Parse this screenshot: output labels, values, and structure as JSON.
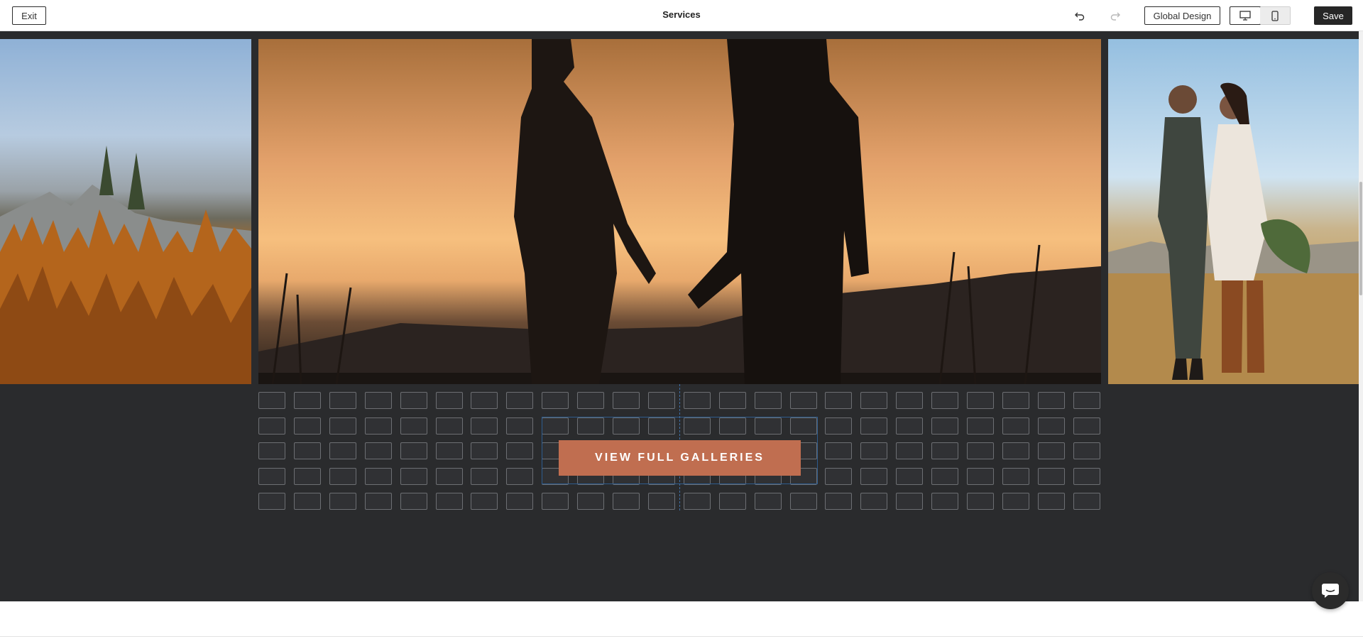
{
  "toolbar": {
    "exit_label": "Exit",
    "page_title": "Services",
    "undo_icon": "undo-icon",
    "redo_icon": "redo-icon",
    "global_design_label": "Global Design",
    "device_desktop_icon": "desktop-icon",
    "device_mobile_icon": "mobile-icon",
    "active_device": "desktop",
    "save_label": "Save"
  },
  "gallery": {
    "images": [
      {
        "name": "autumn-forest-mountains"
      },
      {
        "name": "couple-silhouette-sunset"
      },
      {
        "name": "couple-wedding-field"
      }
    ],
    "grid_columns": 24,
    "grid_rows": 5,
    "cta_label": "VIEW FULL GALLERIES"
  },
  "colors": {
    "canvas_bg": "#2a2b2d",
    "cta_bg": "#c06e50",
    "selection": "#2d5c8f",
    "save_bg": "#262626"
  },
  "chat": {
    "icon": "chat-icon"
  }
}
